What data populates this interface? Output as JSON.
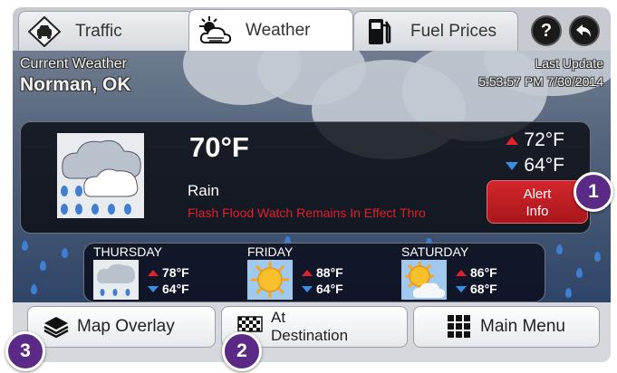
{
  "tabs": [
    {
      "label": "Traffic",
      "icon": "car-warning-icon"
    },
    {
      "label": "Weather",
      "icon": "sun-cloud-icon"
    },
    {
      "label": "Fuel Prices",
      "icon": "fuel-pump-icon"
    }
  ],
  "help_label": "?",
  "current": {
    "title": "Current Weather",
    "location": "Norman, OK",
    "last_update_label": "Last Update",
    "last_update_value": "5:53:57 PM  7/30/2014",
    "temp": "70°F",
    "condition": "Rain",
    "alert_text": "Flash Flood Watch Remains In Effect Thro",
    "high": "72°F",
    "low": "64°F",
    "alert_button": [
      "Alert",
      "Info"
    ]
  },
  "forecast": [
    {
      "day": "THURSDAY",
      "icon": "rain-cloud-icon",
      "high": "78°F",
      "low": "64°F"
    },
    {
      "day": "FRIDAY",
      "icon": "sun-icon",
      "high": "88°F",
      "low": "64°F"
    },
    {
      "day": "SATURDAY",
      "icon": "partly-cloudy-icon",
      "high": "86°F",
      "low": "68°F"
    }
  ],
  "bottom": {
    "map_overlay": "Map Overlay",
    "at_destination_line1": "At",
    "at_destination_line2": "Destination",
    "main_menu": "Main Menu"
  },
  "callouts": [
    "1",
    "2",
    "3"
  ],
  "colors": {
    "alert_red": "#d3262c",
    "high_arrow": "#e0232b",
    "low_arrow": "#3b8ee3",
    "callout_purple": "#5b2a86"
  }
}
